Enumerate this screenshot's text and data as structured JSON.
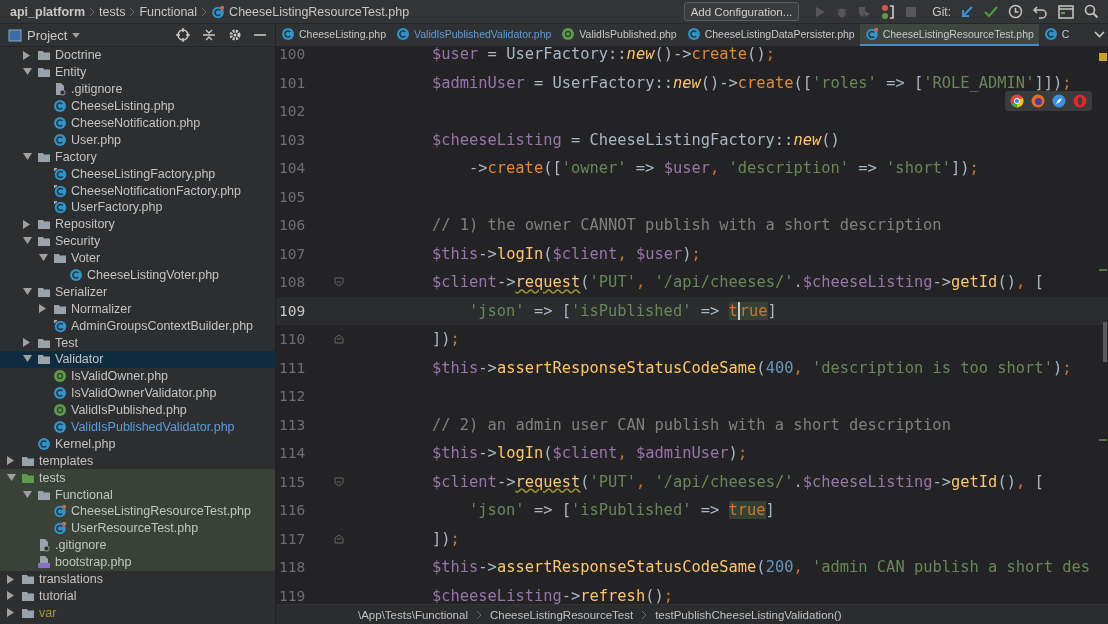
{
  "breadcrumbs": [
    {
      "label": "api_platform",
      "kind": "project"
    },
    {
      "label": "tests",
      "kind": "folder"
    },
    {
      "label": "Functional",
      "kind": "folder"
    },
    {
      "label": "CheeseListingResourceTest.php",
      "kind": "test"
    }
  ],
  "toolbar": {
    "config_button": "Add Configuration...",
    "run_icons": [
      {
        "kind": "run",
        "disabled": true
      },
      {
        "kind": "debug",
        "disabled": true
      },
      {
        "kind": "coverage",
        "disabled": true
      },
      {
        "kind": "profile",
        "disabled": false
      },
      {
        "kind": "stop",
        "disabled": true
      }
    ],
    "git_label": "Git:",
    "git_icons": [
      {
        "kind": "update"
      },
      {
        "kind": "commit"
      },
      {
        "kind": "history"
      },
      {
        "kind": "rollback"
      }
    ],
    "tool_icons": [
      {
        "kind": "window"
      },
      {
        "kind": "search"
      }
    ]
  },
  "project_panel": {
    "title": "Project"
  },
  "tree": {
    "scrolled_branch": [
      {
        "label": "Doctrine",
        "kind": "folder",
        "expanded": false,
        "selected": false,
        "modified": false
      },
      {
        "label": "Entity",
        "kind": "folder",
        "expanded": true,
        "selected": false,
        "modified": false,
        "children": [
          {
            "label": ".gitignore",
            "kind": "ignore",
            "selected": false,
            "modified": false
          },
          {
            "label": "CheeseListing.php",
            "kind": "class",
            "selected": false,
            "modified": false
          },
          {
            "label": "CheeseNotification.php",
            "kind": "class",
            "selected": false,
            "modified": false
          },
          {
            "label": "User.php",
            "kind": "class",
            "selected": false,
            "modified": false
          }
        ]
      },
      {
        "label": "Factory",
        "kind": "folder",
        "expanded": true,
        "selected": false,
        "modified": false,
        "children": [
          {
            "label": "CheeseListingFactory.php",
            "kind": "class_badge",
            "selected": false,
            "modified": false
          },
          {
            "label": "CheeseNotificationFactory.php",
            "kind": "class_badge",
            "selected": false,
            "modified": false
          },
          {
            "label": "UserFactory.php",
            "kind": "class_badge",
            "selected": false,
            "modified": false
          }
        ]
      },
      {
        "label": "Repository",
        "kind": "folder",
        "expanded": false,
        "selected": false,
        "modified": false
      },
      {
        "label": "Security",
        "kind": "folder",
        "expanded": true,
        "selected": false,
        "modified": false,
        "children": [
          {
            "label": "Voter",
            "kind": "folder",
            "expanded": true,
            "selected": false,
            "modified": false,
            "children": [
              {
                "label": "CheeseListingVoter.php",
                "kind": "class",
                "selected": false,
                "modified": false
              }
            ]
          }
        ]
      },
      {
        "label": "Serializer",
        "kind": "folder",
        "expanded": true,
        "selected": false,
        "modified": false,
        "children": [
          {
            "label": "Normalizer",
            "kind": "folder",
            "expanded": false,
            "selected": false,
            "modified": false
          },
          {
            "label": "AdminGroupsContextBuilder.php",
            "kind": "class_badge",
            "selected": false,
            "modified": false
          }
        ]
      },
      {
        "label": "Test",
        "kind": "folder",
        "expanded": false,
        "selected": false,
        "modified": false
      },
      {
        "label": "Validator",
        "kind": "folder",
        "expanded": true,
        "selected": true,
        "modified": false,
        "children": [
          {
            "label": "IsValidOwner.php",
            "kind": "annotation",
            "selected": false,
            "modified": false
          },
          {
            "label": "IsValidOwnerValidator.php",
            "kind": "class",
            "selected": false,
            "modified": false
          },
          {
            "label": "ValidIsPublished.php",
            "kind": "annotation",
            "selected": false,
            "modified": false
          },
          {
            "label": "ValidIsPublishedValidator.php",
            "kind": "class",
            "selected": false,
            "modified": true
          }
        ]
      },
      {
        "label": "Kernel.php",
        "kind": "class",
        "selected": false,
        "modified": false
      }
    ],
    "items": [
      {
        "label": "templates",
        "kind": "folder",
        "expanded": false,
        "selected": false,
        "modified": false
      },
      {
        "label": "tests",
        "kind": "test_folder",
        "expanded": true,
        "selected": false,
        "modified": false,
        "children": [
          {
            "label": "Functional",
            "kind": "folder",
            "expanded": true,
            "selected": false,
            "modified": false,
            "children": [
              {
                "label": "CheeseListingResourceTest.php",
                "kind": "test",
                "selected": false,
                "modified": false
              },
              {
                "label": "UserResourceTest.php",
                "kind": "test",
                "selected": false,
                "modified": false
              }
            ]
          },
          {
            "label": ".gitignore",
            "kind": "ignore",
            "selected": false,
            "modified": false
          },
          {
            "label": "bootstrap.php",
            "kind": "php",
            "selected": false,
            "modified": false
          }
        ]
      },
      {
        "label": "translations",
        "kind": "folder",
        "expanded": false,
        "selected": false,
        "modified": false
      },
      {
        "label": "tutorial",
        "kind": "folder",
        "expanded": false,
        "selected": false,
        "modified": false
      },
      {
        "label": "var",
        "kind": "excluded_folder",
        "expanded": false,
        "selected": false,
        "modified": false
      }
    ]
  },
  "tabs": [
    {
      "label": "CheeseListing.php",
      "kind": "class",
      "selected": false,
      "modified": false
    },
    {
      "label": "ValidIsPublishedValidator.php",
      "kind": "class",
      "selected": false,
      "modified": true
    },
    {
      "label": "ValidIsPublished.php",
      "kind": "annotation",
      "selected": false,
      "modified": false
    },
    {
      "label": "CheeseListingDataPersister.php",
      "kind": "class",
      "selected": false,
      "modified": false
    },
    {
      "label": "CheeseListingResourceTest.php",
      "kind": "test",
      "selected": true,
      "modified": false
    },
    {
      "label": "C",
      "kind": "class",
      "selected": false,
      "modified": false
    }
  ],
  "editor": {
    "lines": [
      {
        "number": "100",
        "current": false,
        "kind": "plain",
        "tokens": [
          {
            "kind": "variable",
            "text": "$user"
          },
          {
            "kind": "plain",
            "text": " = UserFactory::"
          },
          {
            "kind": "static",
            "text": "new"
          },
          {
            "kind": "plain",
            "text": "()->"
          },
          {
            "kind": "call",
            "text": "create"
          },
          {
            "kind": "plain",
            "text": "()"
          },
          {
            "kind": "punct",
            "text": ";"
          }
        ]
      },
      {
        "number": "101",
        "current": false,
        "kind": "plain",
        "tokens": [
          {
            "kind": "variable",
            "text": "$adminUser"
          },
          {
            "kind": "plain",
            "text": " = UserFactory::"
          },
          {
            "kind": "static",
            "text": "new"
          },
          {
            "kind": "plain",
            "text": "()->"
          },
          {
            "kind": "call",
            "text": "create"
          },
          {
            "kind": "plain",
            "text": "(["
          },
          {
            "kind": "string",
            "text": "'roles'"
          },
          {
            "kind": "plain",
            "text": " => ["
          },
          {
            "kind": "string",
            "text": "'ROLE_ADMIN'"
          },
          {
            "kind": "plain",
            "text": "]])"
          },
          {
            "kind": "punct",
            "text": ";"
          }
        ]
      },
      {
        "number": "102",
        "current": false,
        "kind": "plain"
      },
      {
        "number": "103",
        "current": false,
        "kind": "plain",
        "tokens": [
          {
            "kind": "variable",
            "text": "$cheeseListing"
          },
          {
            "kind": "plain",
            "text": " = CheeseListingFactory::"
          },
          {
            "kind": "static",
            "text": "new"
          },
          {
            "kind": "plain",
            "text": "()"
          }
        ]
      },
      {
        "number": "104",
        "current": false,
        "kind": "continuation",
        "tokens": [
          {
            "kind": "plain",
            "text": "->"
          },
          {
            "kind": "call",
            "text": "create"
          },
          {
            "kind": "plain",
            "text": "(["
          },
          {
            "kind": "string",
            "text": "'owner'"
          },
          {
            "kind": "plain",
            "text": " => "
          },
          {
            "kind": "variable",
            "text": "$user"
          },
          {
            "kind": "punct",
            "text": ","
          },
          {
            "kind": "string",
            "text": " 'description'"
          },
          {
            "kind": "plain",
            "text": " => "
          },
          {
            "kind": "string",
            "text": "'short'"
          },
          {
            "kind": "plain",
            "text": "])"
          },
          {
            "kind": "punct",
            "text": ";"
          }
        ]
      },
      {
        "number": "105",
        "current": false,
        "kind": "plain"
      },
      {
        "number": "106",
        "current": false,
        "kind": "plain",
        "tokens": [
          {
            "kind": "comment",
            "text": "// 1) the owner CANNOT publish with a short description"
          }
        ]
      },
      {
        "number": "107",
        "current": false,
        "kind": "plain",
        "tokens": [
          {
            "kind": "variable",
            "text": "$this"
          },
          {
            "kind": "plain",
            "text": "->"
          },
          {
            "kind": "method",
            "text": "logIn"
          },
          {
            "kind": "plain",
            "text": "("
          },
          {
            "kind": "variable",
            "text": "$client"
          },
          {
            "kind": "punct",
            "text": ","
          },
          {
            "kind": "variable",
            "text": " $user"
          },
          {
            "kind": "plain",
            "text": ")"
          },
          {
            "kind": "punct",
            "text": ";"
          }
        ]
      },
      {
        "number": "108",
        "current": false,
        "kind": "fold_start",
        "tokens": [
          {
            "kind": "variable",
            "text": "$client"
          },
          {
            "kind": "plain",
            "text": "->"
          },
          {
            "kind": "wavy",
            "text": "request"
          },
          {
            "kind": "plain",
            "text": "("
          },
          {
            "kind": "string",
            "text": "'PUT'"
          },
          {
            "kind": "punct",
            "text": ","
          },
          {
            "kind": "string",
            "text": " '/api/cheeses/'"
          },
          {
            "kind": "plain",
            "text": "."
          },
          {
            "kind": "variable",
            "text": "$cheeseListing"
          },
          {
            "kind": "plain",
            "text": "->"
          },
          {
            "kind": "method",
            "text": "getId"
          },
          {
            "kind": "plain",
            "text": "()"
          },
          {
            "kind": "punct",
            "text": ","
          },
          {
            "kind": "plain",
            "text": " ["
          }
        ]
      },
      {
        "number": "109",
        "current": true,
        "kind": "continuation",
        "tokens": [
          {
            "kind": "string",
            "text": "'json'"
          },
          {
            "kind": "plain",
            "text": " => ["
          },
          {
            "kind": "string",
            "text": "'isPublished'"
          },
          {
            "kind": "plain",
            "text": " => "
          },
          {
            "kind": "keyword_hl",
            "text": "t"
          },
          {
            "kind": "keyword_caret",
            "text": "rue"
          },
          {
            "kind": "plain",
            "text": "]"
          }
        ]
      },
      {
        "number": "110",
        "current": false,
        "kind": "fold_end",
        "tokens": [
          {
            "kind": "plain",
            "text": "])"
          },
          {
            "kind": "punct",
            "text": ";"
          }
        ]
      },
      {
        "number": "111",
        "current": false,
        "kind": "plain",
        "tokens": [
          {
            "kind": "variable",
            "text": "$this"
          },
          {
            "kind": "plain",
            "text": "->"
          },
          {
            "kind": "method",
            "text": "assertResponseStatusCodeSame"
          },
          {
            "kind": "plain",
            "text": "("
          },
          {
            "kind": "number",
            "text": "400"
          },
          {
            "kind": "punct",
            "text": ","
          },
          {
            "kind": "string",
            "text": " 'description is too short'"
          },
          {
            "kind": "plain",
            "text": ")"
          },
          {
            "kind": "punct",
            "text": ";"
          }
        ]
      },
      {
        "number": "112",
        "current": false,
        "kind": "plain"
      },
      {
        "number": "113",
        "current": false,
        "kind": "plain",
        "tokens": [
          {
            "kind": "comment",
            "text": "// 2) an admin user CAN publish with a short description"
          }
        ]
      },
      {
        "number": "114",
        "current": false,
        "kind": "plain",
        "tokens": [
          {
            "kind": "variable",
            "text": "$this"
          },
          {
            "kind": "plain",
            "text": "->"
          },
          {
            "kind": "method",
            "text": "logIn"
          },
          {
            "kind": "plain",
            "text": "("
          },
          {
            "kind": "variable",
            "text": "$client"
          },
          {
            "kind": "punct",
            "text": ","
          },
          {
            "kind": "variable",
            "text": " $adminUser"
          },
          {
            "kind": "plain",
            "text": ")"
          },
          {
            "kind": "punct",
            "text": ";"
          }
        ]
      },
      {
        "number": "115",
        "current": false,
        "kind": "fold_start",
        "tokens": [
          {
            "kind": "variable",
            "text": "$client"
          },
          {
            "kind": "plain",
            "text": "->"
          },
          {
            "kind": "wavy",
            "text": "request"
          },
          {
            "kind": "plain",
            "text": "("
          },
          {
            "kind": "string",
            "text": "'PUT'"
          },
          {
            "kind": "punct",
            "text": ","
          },
          {
            "kind": "string",
            "text": " '/api/cheeses/'"
          },
          {
            "kind": "plain",
            "text": "."
          },
          {
            "kind": "variable",
            "text": "$cheeseListing"
          },
          {
            "kind": "plain",
            "text": "->"
          },
          {
            "kind": "method",
            "text": "getId"
          },
          {
            "kind": "plain",
            "text": "()"
          },
          {
            "kind": "punct",
            "text": ","
          },
          {
            "kind": "plain",
            "text": " ["
          }
        ]
      },
      {
        "number": "116",
        "current": false,
        "kind": "continuation",
        "tokens": [
          {
            "kind": "string",
            "text": "'json'"
          },
          {
            "kind": "plain",
            "text": " => ["
          },
          {
            "kind": "string",
            "text": "'isPublished'"
          },
          {
            "kind": "plain",
            "text": " => "
          },
          {
            "kind": "keyword_hl",
            "text": "true"
          },
          {
            "kind": "plain",
            "text": "]"
          }
        ]
      },
      {
        "number": "117",
        "current": false,
        "kind": "fold_end",
        "tokens": [
          {
            "kind": "plain",
            "text": "])"
          },
          {
            "kind": "punct",
            "text": ";"
          }
        ]
      },
      {
        "number": "118",
        "current": false,
        "kind": "plain",
        "tokens": [
          {
            "kind": "variable",
            "text": "$this"
          },
          {
            "kind": "plain",
            "text": "->"
          },
          {
            "kind": "method",
            "text": "assertResponseStatusCodeSame"
          },
          {
            "kind": "plain",
            "text": "("
          },
          {
            "kind": "number",
            "text": "200"
          },
          {
            "kind": "punct",
            "text": ","
          },
          {
            "kind": "string",
            "text": " 'admin CAN publish a short des"
          }
        ]
      },
      {
        "number": "119",
        "current": false,
        "kind": "plain",
        "tokens": [
          {
            "kind": "variable",
            "text": "$cheeseListing"
          },
          {
            "kind": "plain",
            "text": "->"
          },
          {
            "kind": "method",
            "text": "refresh"
          },
          {
            "kind": "plain",
            "text": "()"
          },
          {
            "kind": "punct",
            "text": ";"
          }
        ]
      }
    ],
    "browser_popup": [
      {
        "kind": "chrome"
      },
      {
        "kind": "firefox"
      },
      {
        "kind": "safari"
      },
      {
        "kind": "opera"
      }
    ]
  },
  "status_breadcrumbs": [
    "\\App\\Tests\\Functional",
    "CheeseListingResourceTest",
    "testPublishCheeseListingValidation()"
  ]
}
